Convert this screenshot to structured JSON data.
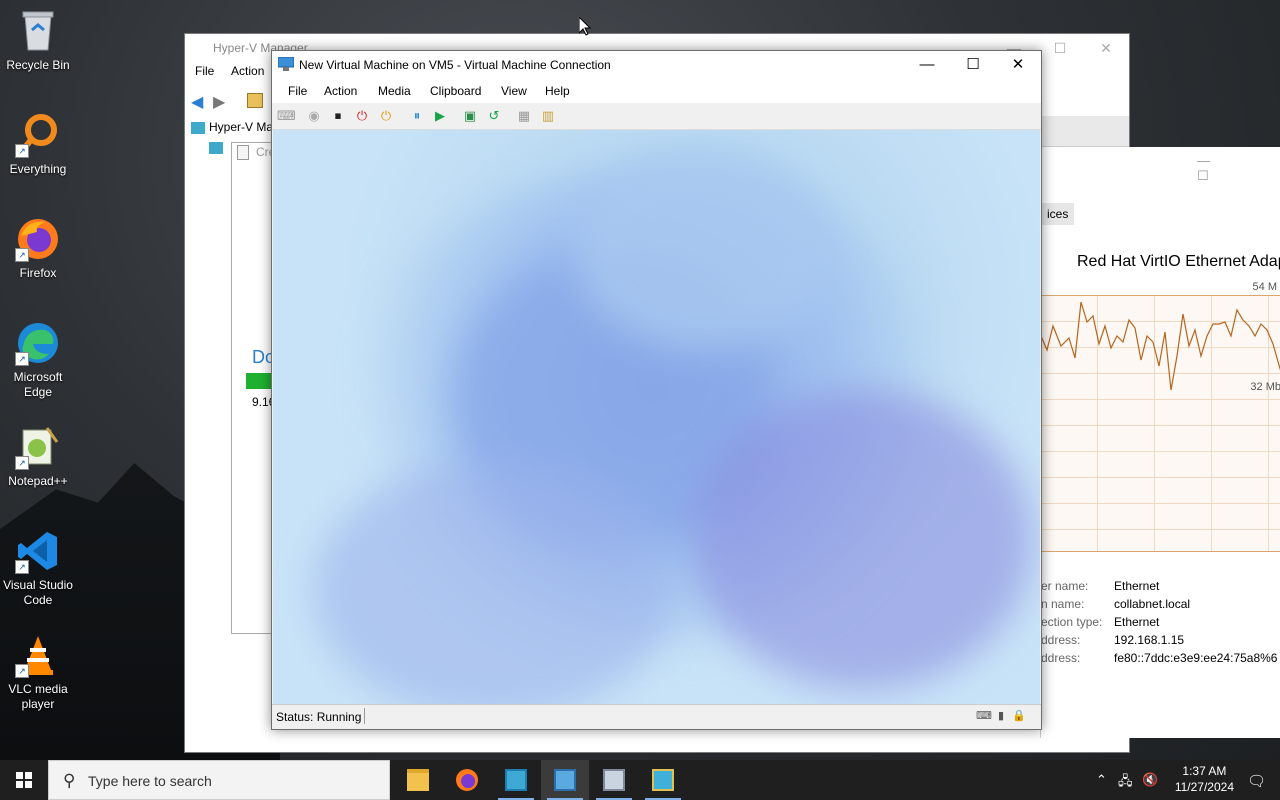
{
  "desktop": {
    "icons": [
      {
        "label": "Recycle Bin"
      },
      {
        "label": "Everything"
      },
      {
        "label": "Firefox"
      },
      {
        "label": "Microsoft Edge"
      },
      {
        "label": "Notepad++"
      },
      {
        "label": "Visual Studio Code"
      },
      {
        "label": "VLC media player"
      }
    ]
  },
  "hyperv": {
    "title": "Hyper-V Manager",
    "menu": [
      "File",
      "Action"
    ],
    "tree_root": "Hyper-V Ma",
    "tree_child": "Cre",
    "center_title": "Do",
    "center_value": "9.16"
  },
  "taskmanager": {
    "tab": "ices",
    "adapter": "Red Hat VirtIO Ethernet Adapt",
    "max_label": "54 M",
    "mid_label": "32 Mb",
    "info": [
      {
        "label": "er name:",
        "value": "Ethernet"
      },
      {
        "label": "n name:",
        "value": "collabnet.local"
      },
      {
        "label": "ection type:",
        "value": "Ethernet"
      },
      {
        "label": "ddress:",
        "value": "192.168.1.15"
      },
      {
        "label": "ddress:",
        "value": "fe80::7ddc:e3e9:ee24:75a8%6"
      }
    ],
    "accent": "#d9a670"
  },
  "vm": {
    "title": "New Virtual Machine on VM5 - Virtual Machine Connection",
    "menu": [
      "File",
      "Action",
      "Media",
      "Clipboard",
      "View",
      "Help"
    ],
    "status": "Status: Running"
  },
  "taskbar": {
    "search_placeholder": "Type here to search",
    "time": "1:37 AM",
    "date": "11/27/2024"
  }
}
